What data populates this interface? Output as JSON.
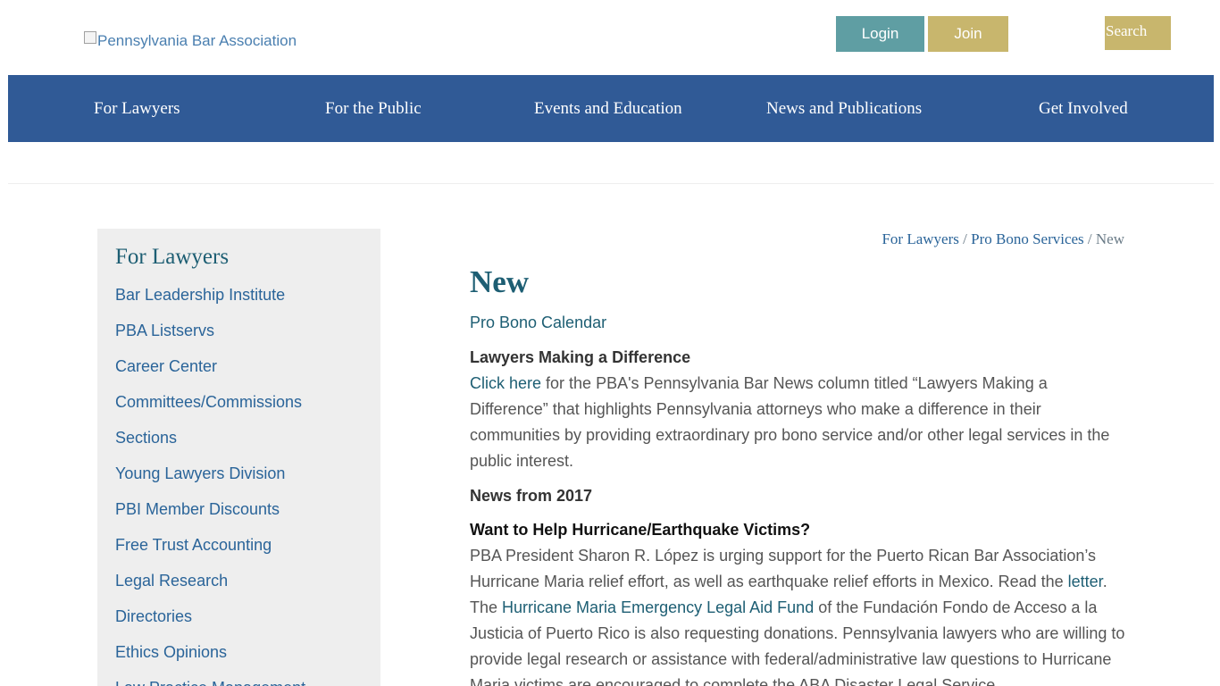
{
  "header": {
    "logo_alt": "Pennsylvania Bar Association",
    "login_label": "Login",
    "join_label": "Join",
    "search_label": "Search"
  },
  "nav": {
    "items": [
      {
        "label": "For Lawyers"
      },
      {
        "label": "For the Public"
      },
      {
        "label": "Events and Education"
      },
      {
        "label": "News and Publications"
      },
      {
        "label": "Get Involved"
      }
    ]
  },
  "sidebar": {
    "title": "For Lawyers",
    "items": [
      {
        "label": "Bar Leadership Institute"
      },
      {
        "label": "PBA Listservs"
      },
      {
        "label": "Career Center"
      },
      {
        "label": "Committees/Commissions"
      },
      {
        "label": "Sections"
      },
      {
        "label": "Young Lawyers Division"
      },
      {
        "label": "PBI Member Discounts"
      },
      {
        "label": "Free Trust Accounting"
      },
      {
        "label": "Legal Research"
      },
      {
        "label": "Directories"
      },
      {
        "label": "Ethics Opinions"
      },
      {
        "label": "Law Practice Management"
      }
    ]
  },
  "breadcrumb": {
    "items": [
      "For Lawyers",
      "Pro Bono Services",
      "New"
    ],
    "separator": " / "
  },
  "main": {
    "title": "New",
    "calendar_link": "Pro Bono Calendar",
    "section1": {
      "heading": "Lawyers Making a Difference",
      "link": "Click here",
      "text": " for the PBA's Pennsylvania Bar News column titled “Lawyers Making a Difference” that highlights Pennsylvania attorneys who make a difference in their communities by providing extraordinary pro bono service and/or other legal services in the public interest."
    },
    "news_year": "News from 2017",
    "section2": {
      "heading": "Want to Help Hurricane/Earthquake Victims?",
      "text1": "PBA President Sharon R. López is urging support for the Puerto Rican Bar Association’s Hurricane Maria relief effort, as well as earthquake relief efforts in Mexico. Read the ",
      "link1": "letter",
      "text2": ". The ",
      "link2": "Hurricane Maria Emergency Legal Aid Fund",
      "text3": " of the Fundación Fondo de Acceso a la Justicia of Puerto Rico is also requesting donations. Pennsylvania lawyers who are willing to provide legal research or assistance with federal/administrative law questions to Hurricane Maria victims are encouraged to complete the ABA Disaster Legal Service"
    }
  }
}
